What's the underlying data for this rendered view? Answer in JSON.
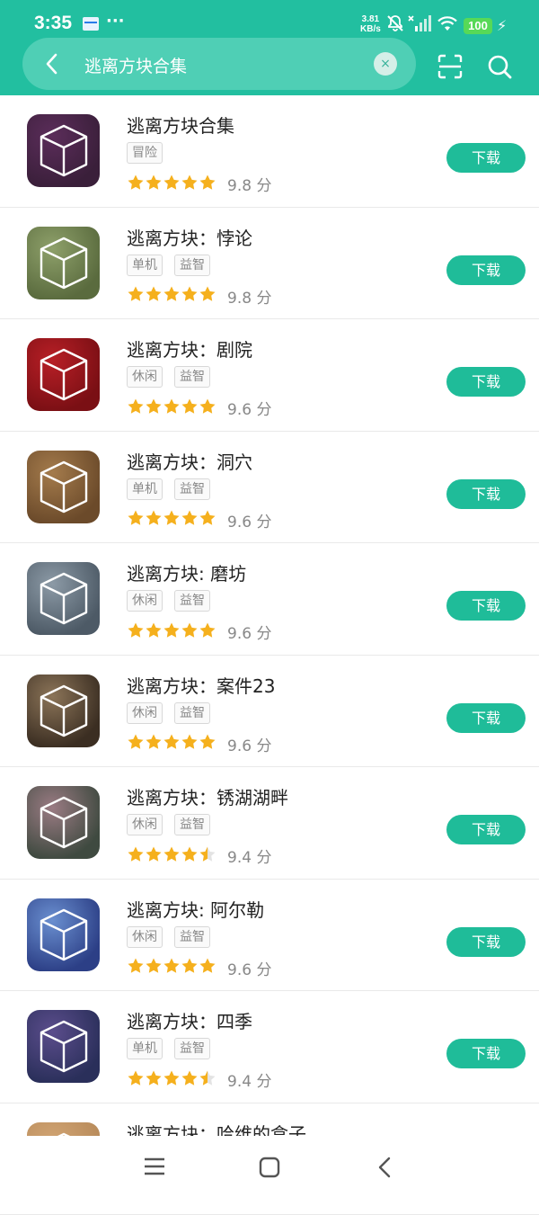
{
  "status_bar": {
    "time": "3:35",
    "more": "···",
    "net_speed_value": "3.81",
    "net_speed_unit": "KB/s",
    "battery": "100"
  },
  "search": {
    "query": "逃离方块合集",
    "clear_icon": "×"
  },
  "download_label": "下载",
  "score_unit": "分",
  "items": [
    {
      "title": "逃离方块合集",
      "tags": [
        "冒险"
      ],
      "rating": 9.8,
      "score": "9.8",
      "stars": 5,
      "icon_bg": "#3a1f3a",
      "icon_accent": "#5b2d5a"
    },
    {
      "title": "逃离方块：悖论",
      "tags": [
        "单机",
        "益智"
      ],
      "rating": 9.8,
      "score": "9.8",
      "stars": 5,
      "icon_bg": "#5a6b3e",
      "icon_accent": "#8ea06a"
    },
    {
      "title": "逃离方块：剧院",
      "tags": [
        "休闲",
        "益智"
      ],
      "rating": 9.6,
      "score": "9.6",
      "stars": 5,
      "icon_bg": "#7a0f14",
      "icon_accent": "#b81f26"
    },
    {
      "title": "逃离方块：洞穴",
      "tags": [
        "单机",
        "益智"
      ],
      "rating": 9.6,
      "score": "9.6",
      "stars": 5,
      "icon_bg": "#6b4a2a",
      "icon_accent": "#a47b4c"
    },
    {
      "title": "逃离方块: 磨坊",
      "tags": [
        "休闲",
        "益智"
      ],
      "rating": 9.6,
      "score": "9.6",
      "stars": 5,
      "icon_bg": "#4d5a66",
      "icon_accent": "#8c9aa6"
    },
    {
      "title": "逃离方块：案件23",
      "tags": [
        "休闲",
        "益智"
      ],
      "rating": 9.6,
      "score": "9.6",
      "stars": 5,
      "icon_bg": "#3b2e22",
      "icon_accent": "#8b7458"
    },
    {
      "title": "逃离方块：锈湖湖畔",
      "tags": [
        "休闲",
        "益智"
      ],
      "rating": 9.4,
      "score": "9.4",
      "stars": 4.5,
      "icon_bg": "#3f4a40",
      "icon_accent": "#9a7b83"
    },
    {
      "title": "逃离方块: 阿尔勒",
      "tags": [
        "休闲",
        "益智"
      ],
      "rating": 9.6,
      "score": "9.6",
      "stars": 5,
      "icon_bg": "#2c3f86",
      "icon_accent": "#6a8fd0"
    },
    {
      "title": "逃离方块：四季",
      "tags": [
        "单机",
        "益智"
      ],
      "rating": 9.4,
      "score": "9.4",
      "stars": 4.5,
      "icon_bg": "#2a2f5a",
      "icon_accent": "#5b4d8c"
    },
    {
      "title": "逃离方块：哈维的盒子",
      "tags": [],
      "rating": null,
      "score": "",
      "stars": 0,
      "icon_bg": "#b78a5a",
      "icon_accent": "#d2a574"
    }
  ],
  "colors": {
    "brand": "#22bfa0",
    "download_button": "#1fbc99",
    "star": "#f5b01d"
  }
}
